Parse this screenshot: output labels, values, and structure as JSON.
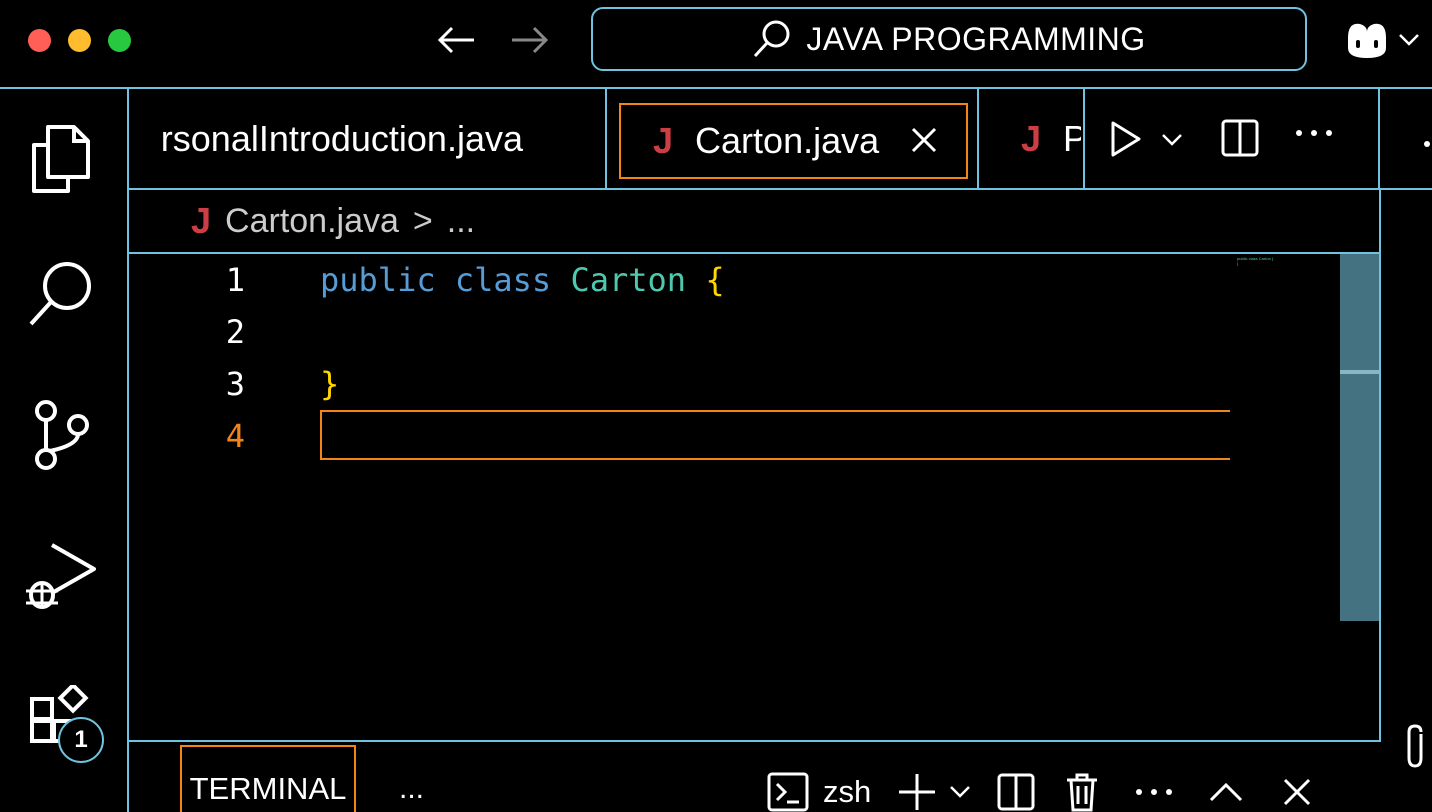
{
  "search": {
    "text": "JAVA PROGRAMMING"
  },
  "tabs": [
    {
      "label": "rsonalIntroduction.java"
    },
    {
      "label": "Carton.java",
      "active": true
    },
    {
      "label": "P"
    }
  ],
  "breadcrumb": {
    "file": "Carton.java",
    "sep": ">",
    "more": "..."
  },
  "editor": {
    "lines": [
      {
        "number": "1"
      },
      {
        "number": "2"
      },
      {
        "number": "3"
      },
      {
        "number": "4",
        "current": true
      }
    ],
    "code": {
      "line1_kw1": "public",
      "line1_kw2": "class",
      "line1_class": "Carton",
      "line1_brace": "{",
      "line3_brace": "}"
    },
    "minimap": {
      "line1": "public class Carton {",
      "line2": "}"
    }
  },
  "activity": {
    "extensions_badge": "1"
  },
  "panel": {
    "tab_label": "TERMINAL",
    "more": "...",
    "shell": "zsh"
  },
  "colors": {
    "border": "#6fc3df",
    "focus": "#f38518",
    "keyword": "#569cd6",
    "class": "#4ec9b0",
    "brace": "#ffd700",
    "java_icon": "#cc3e44"
  }
}
